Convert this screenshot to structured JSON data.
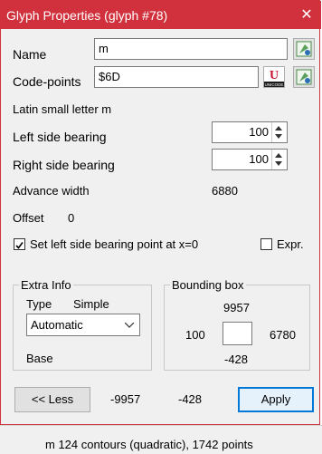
{
  "window": {
    "title": "Glyph Properties (glyph #78)",
    "close_glyph": "✕"
  },
  "fields": {
    "name_label": "Name",
    "name_value": "m",
    "codepoints_label": "Code-points",
    "codepoints_value": "$6D",
    "unicode_badge_text": "UNICODE",
    "description": "Latin small letter m",
    "lsb_label": "Left side bearing",
    "lsb_value": "100",
    "rsb_label": "Right side bearing",
    "rsb_value": "100",
    "advance_label": "Advance width",
    "advance_value": "6880",
    "offset_label": "Offset",
    "offset_value": "0",
    "set_lsb_label": "Set left side bearing point at x=0",
    "set_lsb_checked": true,
    "expr_label": "Expr.",
    "expr_checked": false
  },
  "extra_info": {
    "group_label": "Extra Info",
    "type_label": "Type",
    "type_value": "Simple",
    "select_value": "Automatic",
    "base_label": "Base"
  },
  "bounding_box": {
    "group_label": "Bounding box",
    "top": "9957",
    "left": "100",
    "right": "6780",
    "bottom": "-428"
  },
  "footer": {
    "less_button": "<< Less",
    "value_a": "-9957",
    "value_b": "-428",
    "apply_button": "Apply"
  },
  "status_bar": {
    "text": "m   124 contours (quadratic), 1742 points"
  },
  "colors": {
    "title_bar": "#d1313d",
    "focus_border": "#0078d7"
  }
}
